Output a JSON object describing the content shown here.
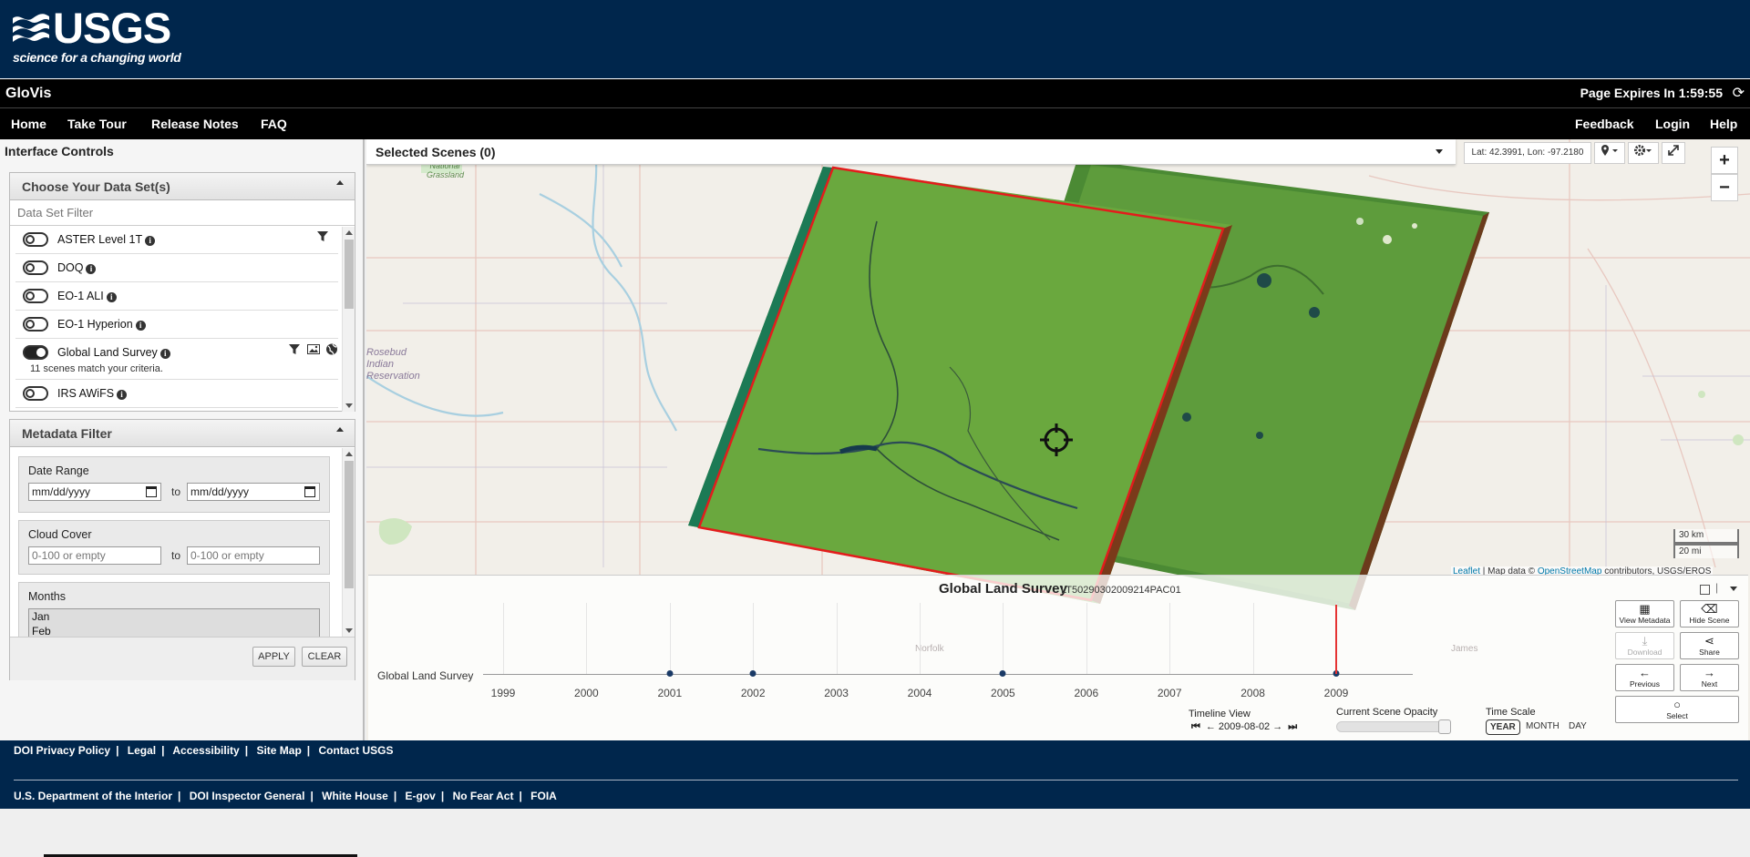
{
  "header": {
    "logo_text": "USGS",
    "logo_tagline": "science for a changing world",
    "app_title": "GloVis",
    "page_expires": "Page Expires In 1:59:55",
    "refresh_icon": "refresh-icon"
  },
  "nav": {
    "left": [
      "Home",
      "Take Tour",
      "Release Notes",
      "FAQ"
    ],
    "right": [
      "Feedback",
      "Login",
      "Help"
    ]
  },
  "left_panel": {
    "title": "Interface Controls",
    "datasets": {
      "heading": "Choose Your Data Set(s)",
      "filter_placeholder": "Data Set Filter",
      "items": [
        {
          "label": "ASTER Level 1T",
          "on": false,
          "sub": ""
        },
        {
          "label": "DOQ",
          "on": false,
          "sub": ""
        },
        {
          "label": "EO-1 ALI",
          "on": false,
          "sub": ""
        },
        {
          "label": "EO-1 Hyperion",
          "on": false,
          "sub": ""
        },
        {
          "label": "Global Land Survey",
          "on": true,
          "sub": "11 scenes match your criteria."
        },
        {
          "label": "IRS AWiFS",
          "on": false,
          "sub": ""
        }
      ]
    },
    "metadata_filter": {
      "heading": "Metadata Filter",
      "date_range_label": "Date Range",
      "date_placeholder": "mm/dd/yyyy",
      "to_label": "to",
      "cloud_cover_label": "Cloud Cover",
      "cloud_placeholder": "0-100 or empty",
      "months_label": "Months",
      "months_visible": [
        "Jan",
        "Feb"
      ],
      "apply": "APPLY",
      "clear": "CLEAR"
    }
  },
  "map": {
    "selected_scenes": "Selected Scenes (0)",
    "coords": "Lat: 42.3991, Lon: -97.2180",
    "zoom_in": "+",
    "zoom_out": "−",
    "scale_km": "30 km",
    "scale_mi": "20 mi",
    "attribution_leaflet": "Leaflet",
    "attribution_text": " | Map data © ",
    "attribution_osm": "OpenStreetMap",
    "attribution_rest": " contributors, USGS/EROS",
    "place_labels": [
      "National Grassland",
      "Rosebud Indian Reservation",
      "Norfolk",
      "James"
    ]
  },
  "timeline": {
    "title": "Global Land Survey",
    "scene_id": "LT50290302009214PAC01",
    "row_label": "Global Land Survey",
    "years": [
      "1999",
      "2000",
      "2001",
      "2002",
      "2003",
      "2004",
      "2005",
      "2006",
      "2007",
      "2008",
      "2009"
    ],
    "scene_years": [
      "2001",
      "2002",
      "2005",
      "2009"
    ],
    "current_year": "2009",
    "buttons": {
      "view_metadata": "View Metadata",
      "hide_scene": "Hide Scene",
      "download": "Download",
      "share": "Share",
      "previous": "Previous",
      "next": "Next",
      "select": "Select"
    },
    "timeline_view_label": "Timeline View",
    "current_date": "2009-08-02",
    "opacity_label": "Current Scene Opacity",
    "opacity_value": 0.95,
    "time_scale_label": "Time Scale",
    "time_scale_options": [
      "YEAR",
      "MONTH",
      "DAY"
    ],
    "time_scale_active": "YEAR"
  },
  "footer": {
    "row1": [
      "DOI Privacy Policy",
      "Legal",
      "Accessibility",
      "Site Map",
      "Contact USGS"
    ],
    "row2": [
      "U.S. Department of the Interior",
      "DOI Inspector General",
      "White House",
      "E-gov",
      "No Fear Act",
      "FOIA"
    ]
  }
}
